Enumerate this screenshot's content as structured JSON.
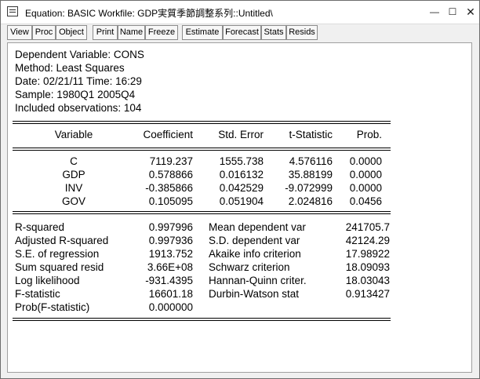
{
  "window": {
    "title": "Equation: BASIC   Workfile: GDP実質季節調整系列::Untitled\\"
  },
  "toolbar": {
    "buttons": [
      "View",
      "Proc",
      "Object",
      "Print",
      "Name",
      "Freeze",
      "Estimate",
      "Forecast",
      "Stats",
      "Resids"
    ]
  },
  "header": {
    "dependent": "Dependent Variable: CONS",
    "method": "Method: Least Squares",
    "date": "Date: 02/21/11   Time: 16:29",
    "sample": "Sample: 1980Q1 2005Q4",
    "observations": "Included observations: 104"
  },
  "coef_table": {
    "columns": [
      "Variable",
      "Coefficient",
      "Std. Error",
      "t-Statistic",
      "Prob."
    ],
    "rows": [
      [
        "C",
        "7119.237",
        "1555.738",
        "4.576116",
        "0.0000"
      ],
      [
        "GDP",
        "0.578866",
        "0.016132",
        "35.88199",
        "0.0000"
      ],
      [
        "INV",
        "-0.385866",
        "0.042529",
        "-9.072999",
        "0.0000"
      ],
      [
        "GOV",
        "0.105095",
        "0.051904",
        "2.024816",
        "0.0456"
      ]
    ]
  },
  "stats": {
    "left": [
      [
        "R-squared",
        "0.997996"
      ],
      [
        "Adjusted R-squared",
        "0.997936"
      ],
      [
        "S.E. of regression",
        "1913.752"
      ],
      [
        "Sum squared resid",
        "3.66E+08"
      ],
      [
        "Log likelihood",
        "-931.4395"
      ],
      [
        "F-statistic",
        "16601.18"
      ],
      [
        "Prob(F-statistic)",
        "0.000000"
      ]
    ],
    "right": [
      [
        "Mean dependent var",
        "241705.7"
      ],
      [
        "S.D. dependent var",
        "42124.29"
      ],
      [
        "Akaike info criterion",
        "17.98922"
      ],
      [
        "Schwarz criterion",
        "18.09093"
      ],
      [
        "Hannan-Quinn criter.",
        "18.03043"
      ],
      [
        "Durbin-Watson stat",
        "0.913427"
      ]
    ]
  }
}
